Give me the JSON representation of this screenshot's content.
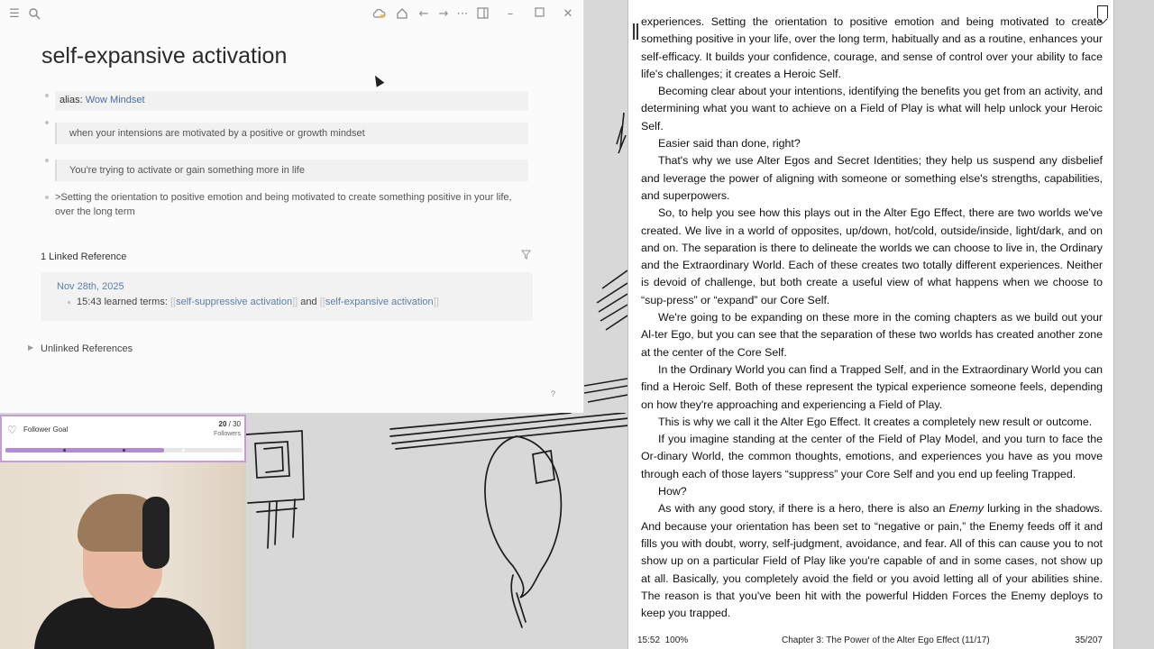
{
  "notes": {
    "title": "self-expansive activation",
    "property": {
      "key": "alias:",
      "value": "Wow Mindset"
    },
    "blocks": [
      "when your intensions are motivated by a positive or growth mindset",
      "You're trying to activate or gain something more in life",
      ">Setting the orientation to positive emotion and being motivated to create something positive in your life, over the long term"
    ],
    "linked_references_label": "1 Linked Reference",
    "reference": {
      "date": "Nov 28th, 2025",
      "text_before": "15:43 learned terms: ",
      "link1": "self-suppressive activation",
      "text_mid": " and ",
      "link2": "self-expansive activation",
      "open_brackets": "[[",
      "close_brackets": "]]"
    },
    "unlinked_label": "Unlinked References",
    "help_label": "?"
  },
  "goal": {
    "label": "Follower Goal",
    "current": "20",
    "separator": " / ",
    "target": "30",
    "unit": "Followers",
    "progress_percent": 67,
    "accent": "#b48ad6"
  },
  "reader": {
    "paragraphs": [
      "experiences. Setting the orientation to positive emotion and being motivated to create something positive in your life, over the long term, habitually and as a routine, enhances your self-efficacy. It builds your confidence, courage, and sense of control over your ability to face life's challenges; it creates a Heroic Self.",
      "Becoming clear about your intentions, identifying the benefits you get from an activity, and determining what you want to achieve on a Field of Play is what will help unlock your Heroic Self.",
      "Easier said than done, right?",
      "That's why we use Alter Egos and Secret Identities; they help us suspend any disbelief and leverage the power of aligning with someone or something else's strengths, capabilities, and superpowers.",
      "So, to help you see how this plays out in the Alter Ego Effect, there are two worlds we've created. We live in a world of opposites, up/down, hot/cold, outside/inside, light/dark, and on and on. The separation is there to delineate the worlds we can choose to live in, the Ordinary and the Extraordinary World. Each of these creates two totally different experiences. Neither is devoid of challenge, but both create a useful view of what happens when we choose to “sup-press” or “expand” our Core Self.",
      "We're going to be expanding on these more in the coming chapters as we build out your Al-ter Ego, but you can see that the separation of these two worlds has created another zone at the center of the Core Self.",
      "In the Ordinary World you can find a Trapped Self, and in the Extraordinary World you can find a Heroic Self. Both of these represent the typical experience someone feels, depending on how they're approaching and experiencing a Field of Play.",
      "This is why we call it the Alter Ego Effect. It creates a completely new result or outcome.",
      "If you imagine standing at the center of the Field of Play Model, and you turn to face the Or-dinary World, the common thoughts, emotions, and experiences you have as you move through each of those layers “suppress” your Core Self and you end up feeling Trapped.",
      "How?"
    ],
    "last_paragraph": {
      "before": "As with any good story, if there is a hero, there is also an ",
      "emphasis": "Enemy",
      "after": " lurking in the shadows. And because your orientation has been set to “negative or pain,” the Enemy feeds off it and fills you with doubt, worry, self-judgment, avoidance, and fear. All of this can cause you to not show up on a particular Field of Play like you're capable of and in some cases, not show up at all. Basically, you completely avoid the field or you avoid letting all of your abilities shine. The reason is that you've been hit with the powerful Hidden Forces the Enemy deploys to keep you trapped."
    },
    "footer": {
      "time": "15:52",
      "battery": "100%",
      "chapter": "Chapter 3: The Power of the Alter Ego Effect (11/17)",
      "page": "35/207"
    }
  }
}
